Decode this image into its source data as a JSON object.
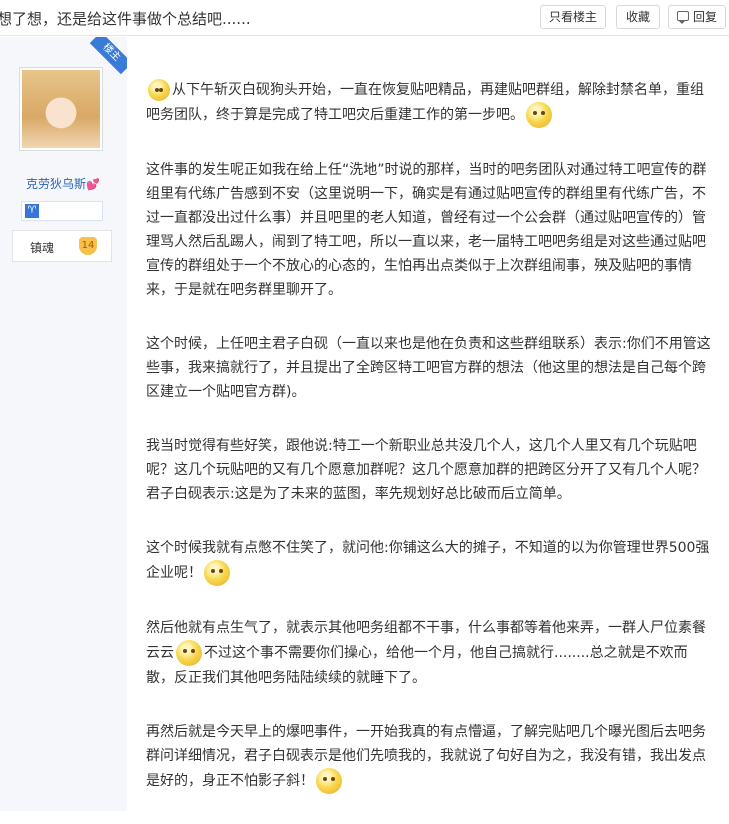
{
  "header": {
    "title": "想了想，还是给这件事做个总结吧......",
    "buttons": {
      "only_op": "只看楼主",
      "favorite": "收藏",
      "reply": "回复"
    }
  },
  "user": {
    "badge": "楼主",
    "name": "克劳狄乌斯",
    "heart": "💕",
    "zodiac": "♈",
    "level_title": "镇魂",
    "level": "14"
  },
  "post": {
    "paragraphs": [
      {
        "before": "",
        "emoji1": "thumbs-up-emoji",
        "text1": "从下午斩灭白砚狗头开始，一直在恢复贴吧精品，再建贴吧群组，解除封禁名单，重组吧务团队，终于算是完成了特工吧灾后重建工作的第一步吧。",
        "emoji2": "crying-laugh-emoji",
        "text2": ""
      },
      {
        "text1": "这件事的发生呢正如我在给上任“洗地”时说的那样，当时的吧务团队对通过特工吧宣传的群组里有代练广告感到不安（这里说明一下，确实是有通过贴吧宣传的群组里有代练广告，不过一直都没出过什么事）并且吧里的老人知道，曾经有过一个公会群（通过贴吧宣传的）管理骂人然后乱踢人，闹到了特工吧，所以一直以来，老一届特工吧吧务组是对这些通过贴吧宣传的群组处于一个不放心的心态的，生怕再出点类似于上次群组闹事，殃及贴吧的事情来，于是就在吧务群里聊开了。"
      },
      {
        "text1": "这个时候，上任吧主君子白砚（一直以来也是他在负责和这些群组联系）表示:你们不用管这些事，我来搞就行了，并且提出了全跨区特工吧官方群的想法（他这里的想法是自己每个跨区建立一个贴吧官方群)。"
      },
      {
        "text1": "我当时觉得有些好笑，跟他说:特工一个新职业总共没几个人，这几个人里又有几个玩贴吧呢？这几个玩贴吧的又有几个愿意加群呢？这几个愿意加群的把跨区分开了又有几个人呢？君子白砚表示:这是为了未来的蓝图，率先规划好总比破而后立简单。"
      },
      {
        "text1": "这个时候我就有点憋不住笑了，就问他:你铺这么大的摊子，不知道的以为你管理世界500强企业呢！",
        "emoji2": "laughing-emoji"
      },
      {
        "text1": "然后他就有点生气了，就表示其他吧务组都不干事，什么事都等着他来弄，一群人尸位素餐云云",
        "emoji2": "awkward-emoji",
        "text2": "不过这个事不需要你们操心，给他一个月，他自己搞就行........总之就是不欢而散，反正我们其他吧务陆陆续续的就睡下了。"
      },
      {
        "text1": "再然后就是今天早上的爆吧事件，一开始我真的有点懵逼，了解完贴吧几个曝光图后去吧务群问详细情况，君子白砚表示是他们先喷我的，我就说了句好自为之，我没有错，我出发点是好的，身正不怕影子斜！",
        "emoji2": "shocked-emoji"
      }
    ]
  }
}
